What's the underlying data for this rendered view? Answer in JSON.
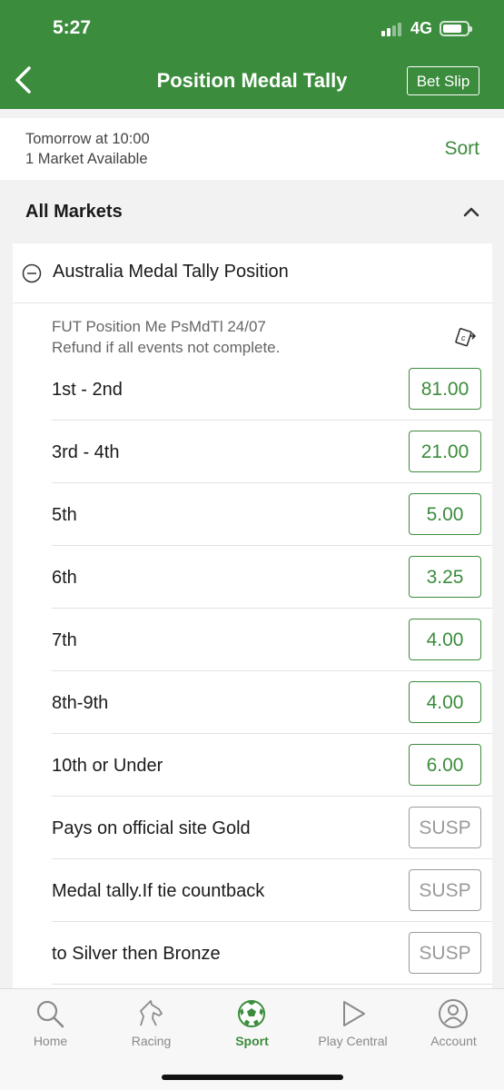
{
  "status": {
    "time": "5:27",
    "network": "4G"
  },
  "nav": {
    "title": "Position Medal Tally",
    "bet_slip_label": "Bet Slip"
  },
  "info": {
    "when": "Tomorrow at 10:00",
    "markets": "1 Market Available",
    "sort_label": "Sort"
  },
  "section": {
    "label": "All Markets"
  },
  "market": {
    "name": "Australia Medal Tally Position",
    "note1": "FUT Position Me PsMdTl 24/07",
    "note2": "Refund if all events not complete.",
    "rows": [
      {
        "label": "1st - 2nd",
        "price": "81.00",
        "suspended": false
      },
      {
        "label": "3rd - 4th",
        "price": "21.00",
        "suspended": false
      },
      {
        "label": "5th",
        "price": "5.00",
        "suspended": false
      },
      {
        "label": "6th",
        "price": "3.25",
        "suspended": false
      },
      {
        "label": "7th",
        "price": "4.00",
        "suspended": false
      },
      {
        "label": "8th-9th",
        "price": "4.00",
        "suspended": false
      },
      {
        "label": "10th or Under",
        "price": "6.00",
        "suspended": false
      },
      {
        "label": "Pays on official site Gold",
        "price": "SUSP",
        "suspended": true
      },
      {
        "label": "Medal tally.If tie countback",
        "price": "SUSP",
        "suspended": true
      },
      {
        "label": "to Silver then Bronze",
        "price": "SUSP",
        "suspended": true
      }
    ]
  },
  "tabs": [
    {
      "label": "Home",
      "icon": "search-icon"
    },
    {
      "label": "Racing",
      "icon": "horse-icon"
    },
    {
      "label": "Sport",
      "icon": "soccer-ball-icon",
      "active": true
    },
    {
      "label": "Play Central",
      "icon": "play-icon"
    },
    {
      "label": "Account",
      "icon": "user-icon"
    }
  ],
  "colors": {
    "brand": "#3b8c3c",
    "suspended": "#9a9a9a"
  }
}
